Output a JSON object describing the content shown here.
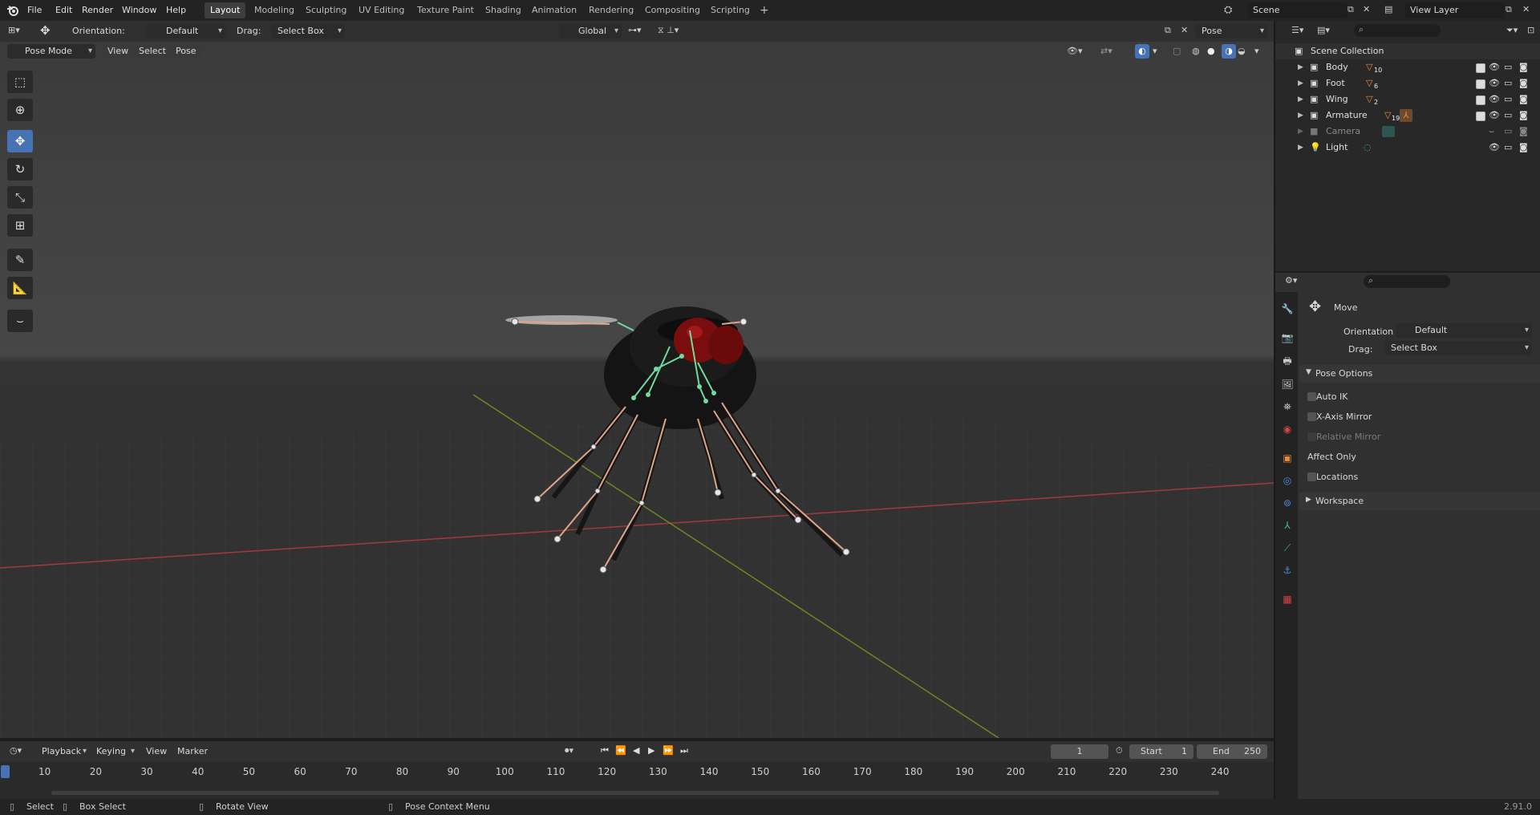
{
  "topbar": {
    "menus": [
      "File",
      "Edit",
      "Render",
      "Window",
      "Help"
    ],
    "workspaces": [
      "Layout",
      "Modeling",
      "Sculpting",
      "UV Editing",
      "Texture Paint",
      "Shading",
      "Animation",
      "Rendering",
      "Compositing",
      "Scripting"
    ],
    "add_tab": "+",
    "scene": "Scene",
    "view_layer": "View Layer"
  },
  "header": {
    "orientation_label": "Orientation:",
    "orientation_value": "Default",
    "drag_label": "Drag:",
    "drag_value": "Select Box",
    "transform_orientation": "Global",
    "pose_options": "Pose Options",
    "mode": "Pose Mode",
    "menu_view": "View",
    "menu_select": "Select",
    "menu_pose": "Pose"
  },
  "toolbar": {
    "tools": [
      "select-box-icon",
      "cursor-icon",
      "move-icon",
      "rotate-icon",
      "scale-icon",
      "transform-icon",
      "annotate-icon",
      "measure-icon",
      "relax-icon"
    ]
  },
  "outliner": {
    "root": "Scene Collection",
    "items": [
      {
        "name": "Body",
        "badge": "10",
        "dim": false
      },
      {
        "name": "Foot",
        "badge": "6",
        "dim": false
      },
      {
        "name": "Wing",
        "badge": "2",
        "dim": false
      },
      {
        "name": "Armature",
        "badge": "19",
        "dim": false
      },
      {
        "name": "Camera",
        "badge": "",
        "dim": true
      },
      {
        "name": "Light",
        "badge": "",
        "dim": false
      }
    ]
  },
  "properties": {
    "tool_name": "Move",
    "orientation_label": "Orientation",
    "orientation_value": "Default",
    "drag_label": "Drag:",
    "drag_value": "Select Box",
    "section_pose_options": "Pose Options",
    "auto_ik": "Auto IK",
    "x_axis_mirror": "X-Axis Mirror",
    "relative_mirror": "Relative Mirror",
    "affect_only": "Affect Only",
    "locations": "Locations",
    "section_workspace": "Workspace"
  },
  "timeline": {
    "menus": [
      "Playback",
      "Keying",
      "View",
      "Marker"
    ],
    "current_frame": "1",
    "start_label": "Start",
    "start_value": "1",
    "end_label": "End",
    "end_value": "250",
    "ticks": [
      "10",
      "20",
      "30",
      "40",
      "50",
      "60",
      "70",
      "80",
      "90",
      "100",
      "110",
      "120",
      "130",
      "140",
      "150",
      "160",
      "170",
      "180",
      "190",
      "200",
      "210",
      "220",
      "230",
      "240"
    ]
  },
  "status": {
    "select": "Select",
    "box_select": "Box Select",
    "rotate_view": "Rotate View",
    "context_menu": "Pose Context Menu",
    "version": "2.91.0"
  },
  "colors": {
    "accent": "#4772b3",
    "bone": "#e0a58a",
    "bone_selected": "#6fdc9e",
    "x_axis": "#a23a3a",
    "y_axis": "#6b8a1f"
  }
}
